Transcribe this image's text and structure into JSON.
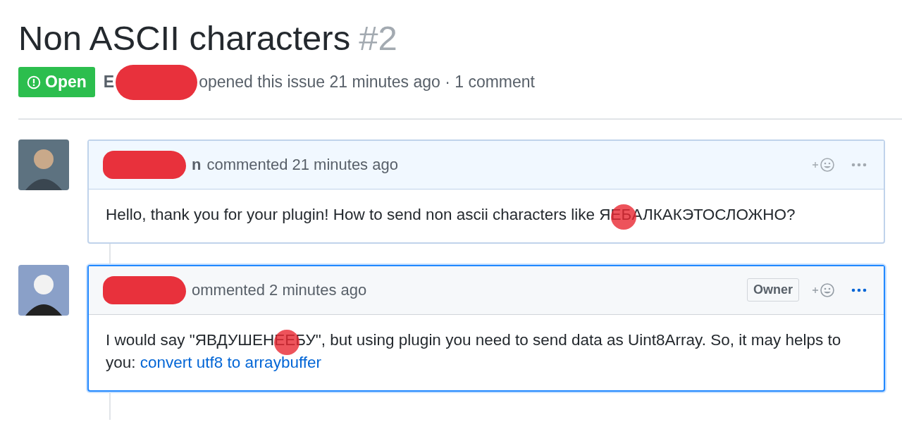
{
  "issue": {
    "title": "Non ASCII characters",
    "number": "#2",
    "state": "Open",
    "author_visible": "E",
    "author_redacted": true,
    "meta": "opened this issue 21 minutes ago · 1 comment"
  },
  "comments": [
    {
      "author_visible": "n",
      "author_redacted": true,
      "action": "commented 21 minutes ago",
      "highlighted": false,
      "body_before": "Hello, thank you for your plugin! How to send non ascii characters like Я",
      "body_covered": "ЕБ",
      "body_after": "АЛКАКЭТОСЛОЖНО?"
    },
    {
      "author_redacted": true,
      "action": "ommented 2 minutes ago",
      "owner_badge": "Owner",
      "highlighted": true,
      "body_before": "I would say \"ЯВДУШЕН",
      "body_covered": "ЕЕ",
      "body_after": "БУ\", but using plugin you need to send data as Uint8Array. So, it may helps to you: ",
      "link": "convert utf8 to arraybuffer"
    }
  ]
}
